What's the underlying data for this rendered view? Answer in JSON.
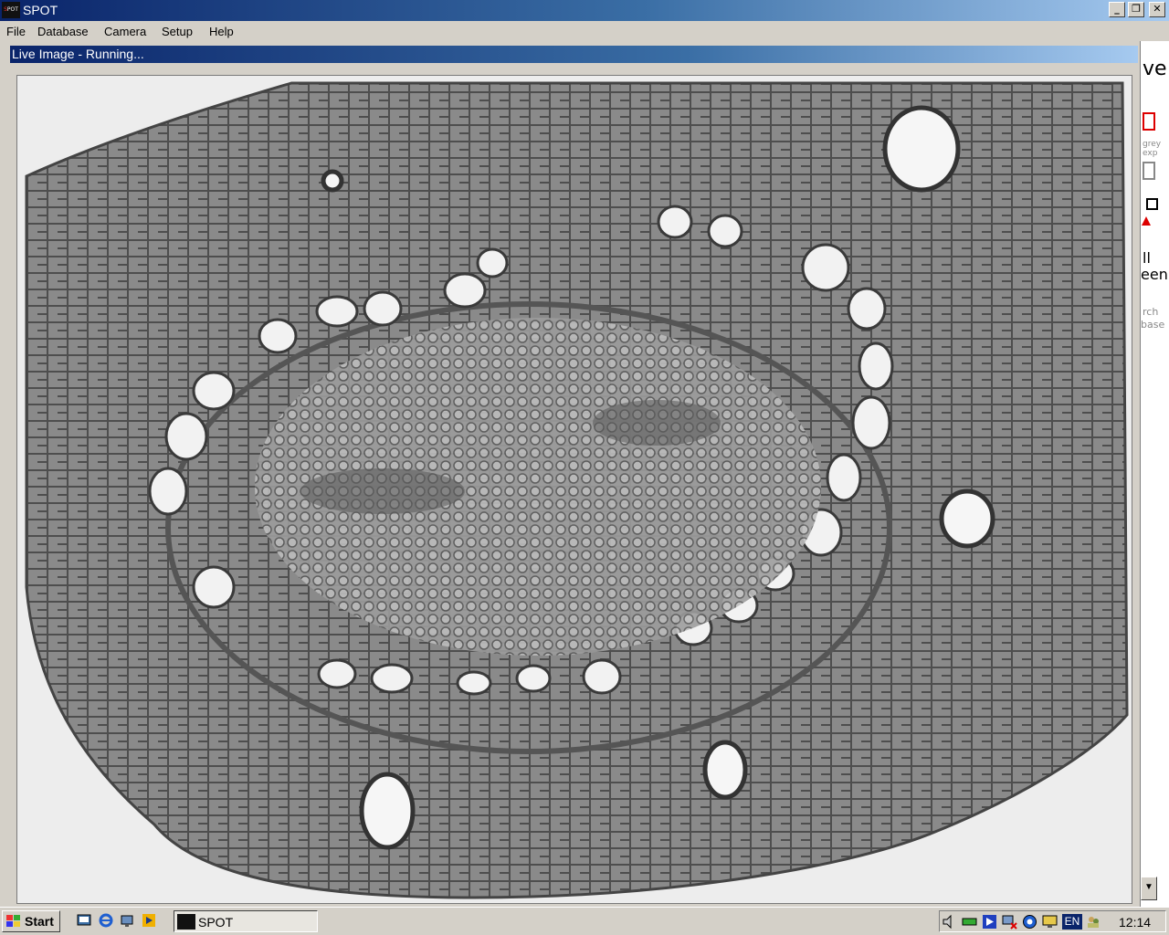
{
  "window": {
    "title": "SPOT",
    "icon": "spot-app-icon",
    "controls": [
      "minimize-icon",
      "maximize-icon",
      "close-icon"
    ]
  },
  "menu": [
    "File",
    "Database",
    "Camera",
    "Setup",
    "Help"
  ],
  "live_image": {
    "caption": "Live Image - Running..."
  },
  "side_panel": {
    "items": [
      {
        "text": "ve",
        "kind": "label"
      },
      {
        "text": "grey",
        "kind": "small-label"
      },
      {
        "text": "exp",
        "kind": "small-label"
      },
      {
        "text": "ll",
        "kind": "label"
      },
      {
        "text": "een",
        "kind": "label"
      },
      {
        "text": "rch",
        "kind": "small-label"
      },
      {
        "text": "base",
        "kind": "small-label"
      }
    ]
  },
  "taskbar": {
    "start_label": "Start",
    "task_label": "SPOT",
    "language": "EN",
    "clock": "12:14"
  }
}
